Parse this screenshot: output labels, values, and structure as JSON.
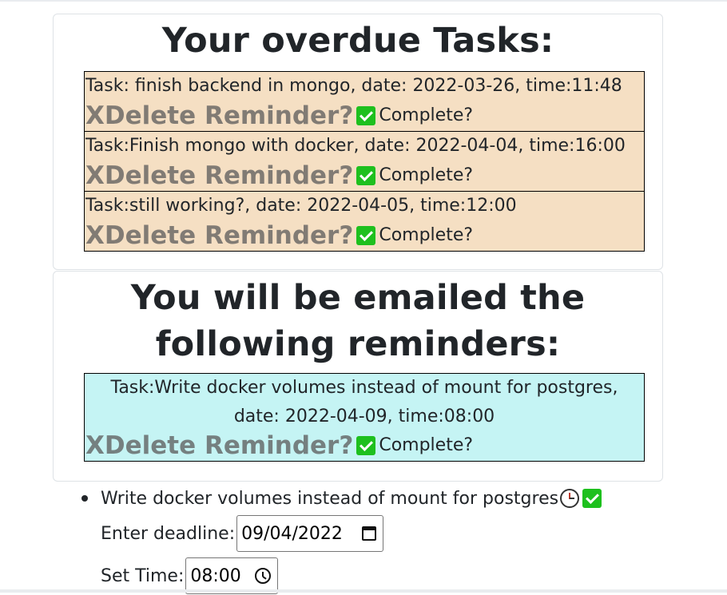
{
  "overdue": {
    "title": "Your overdue Tasks:",
    "tasks": [
      {
        "text": "Task: finish backend in mongo, date: 2022-03-26, time:11:48"
      },
      {
        "text": "Task:Finish mongo with docker, date: 2022-04-04, time:16:00"
      },
      {
        "text": "Task:still working?, date: 2022-04-05, time:12:00"
      }
    ]
  },
  "reminders": {
    "title": "You will be emailed the following reminders:",
    "tasks": [
      {
        "text": "Task:Write docker volumes instead of mount for postgres, date: 2022-04-09, time:08:00"
      }
    ]
  },
  "actions": {
    "delete_label": "XDelete Reminder?",
    "complete_label": "Complete?"
  },
  "todo": {
    "items": [
      {
        "text": "Write docker volumes instead of mount for postgres",
        "deadline_label": "Enter deadline:",
        "deadline_value": "09/04/2022",
        "time_label": "Set Time:",
        "time_value": "08:00"
      }
    ]
  },
  "colors": {
    "overdue_bg": "#f5dfc3",
    "reminder_bg": "#c5f4f4",
    "check_green": "#1ec01e"
  },
  "icons": [
    "check-icon",
    "clock-icon",
    "calendar-icon"
  ]
}
